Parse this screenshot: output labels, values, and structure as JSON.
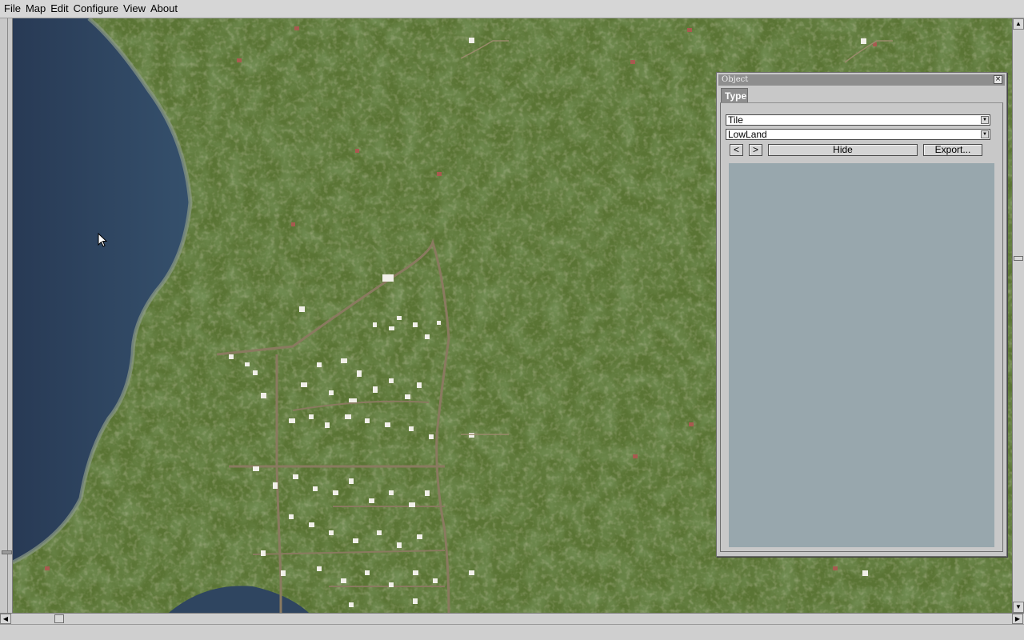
{
  "menu": {
    "items": [
      "File",
      "Map",
      "Edit",
      "Configure",
      "View",
      "About"
    ]
  },
  "panel": {
    "title": "Object",
    "close_glyph": "×",
    "tab_label": "Type",
    "type_select": "Tile",
    "subtype_select": "LowLand",
    "prev_label": "<",
    "next_label": ">",
    "hide_label": "Hide",
    "export_label": "Export..."
  },
  "scroll": {
    "up": "▲",
    "down": "▼",
    "left": "◀",
    "right": "▶"
  },
  "icons": {
    "dropdown": "chevron-down-icon",
    "close": "close-icon",
    "cursor": "arrow-cursor-icon"
  },
  "colors": {
    "water": "#2f4560",
    "forest": "#4f6a2e",
    "road": "#8a7a60",
    "preview": "#98a7ad",
    "panel_title": "#8e8e8e"
  }
}
